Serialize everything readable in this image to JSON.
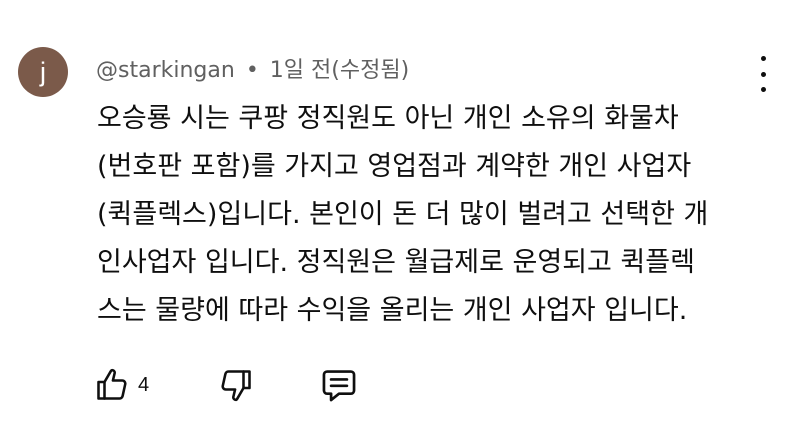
{
  "comment": {
    "avatar_letter": "j",
    "avatar_color": "#7b5a4a",
    "author": "@starkingan",
    "separator": "•",
    "timestamp": "1일 전(수정됨)",
    "lines": [
      "오승룡 시는 쿠팡 정직원도 아닌 개인 소유의 화물차",
      "(번호판 포함)를 가지고 영업점과 계약한 개인 사업자",
      "(퀵플렉스)입니다. 본인이 돈 더 많이 벌려고 선택한 개",
      "인사업자 입니다. 정직원은 월급제로 운영되고 퀵플렉",
      "스는 물량에 따라 수익을 올리는 개인 사업자 입니다."
    ],
    "like_count": "4",
    "icons": {
      "like": "thumbs-up-icon",
      "dislike": "thumbs-down-icon",
      "reply": "reply-icon",
      "menu": "more-vert-icon"
    }
  }
}
